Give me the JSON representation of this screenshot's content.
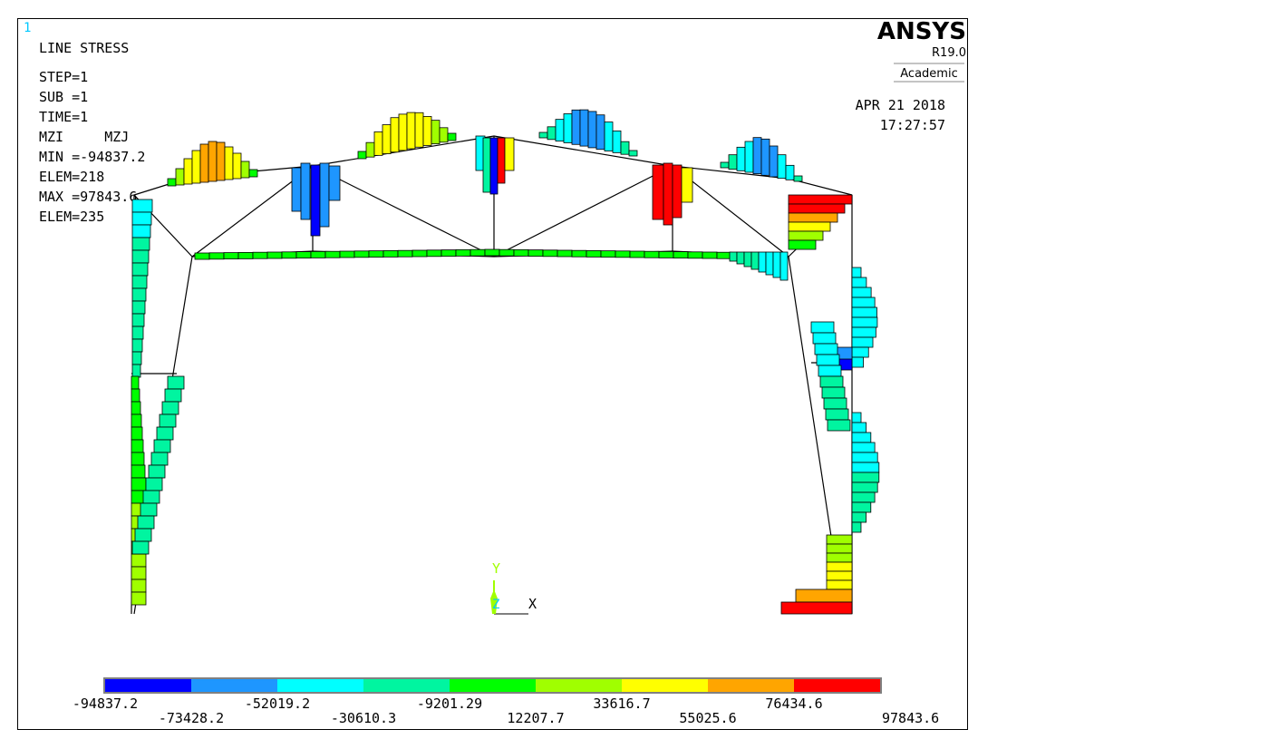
{
  "window_number": "1",
  "plot_title": "LINE STRESS",
  "info": {
    "step": "STEP=1",
    "sub": "SUB =1",
    "time": "TIME=1",
    "items": "MZI     MZJ",
    "min": "MIN =-94837.2",
    "min_elem": "ELEM=218",
    "max": "MAX =97843.6",
    "max_elem": "ELEM=235"
  },
  "logo": {
    "name": "ANSYS",
    "version": "R19.0",
    "edition": "Academic"
  },
  "date": "APR 21 2018",
  "time_of_day": "17:27:57",
  "triad": {
    "y": "Y",
    "z": "Z",
    "x": "X"
  },
  "legend": {
    "colors": [
      "#0000ff",
      "#1e96ff",
      "#00ffff",
      "#00f5a0",
      "#00ff00",
      "#a0ff00",
      "#ffff00",
      "#ffa500",
      "#ff0000"
    ],
    "labels": [
      "-94837.2",
      "-73428.2",
      "-52019.2",
      "-30610.3",
      "-9201.29",
      "12207.7",
      "33616.7",
      "55025.6",
      "76434.6",
      "97843.6"
    ]
  }
}
